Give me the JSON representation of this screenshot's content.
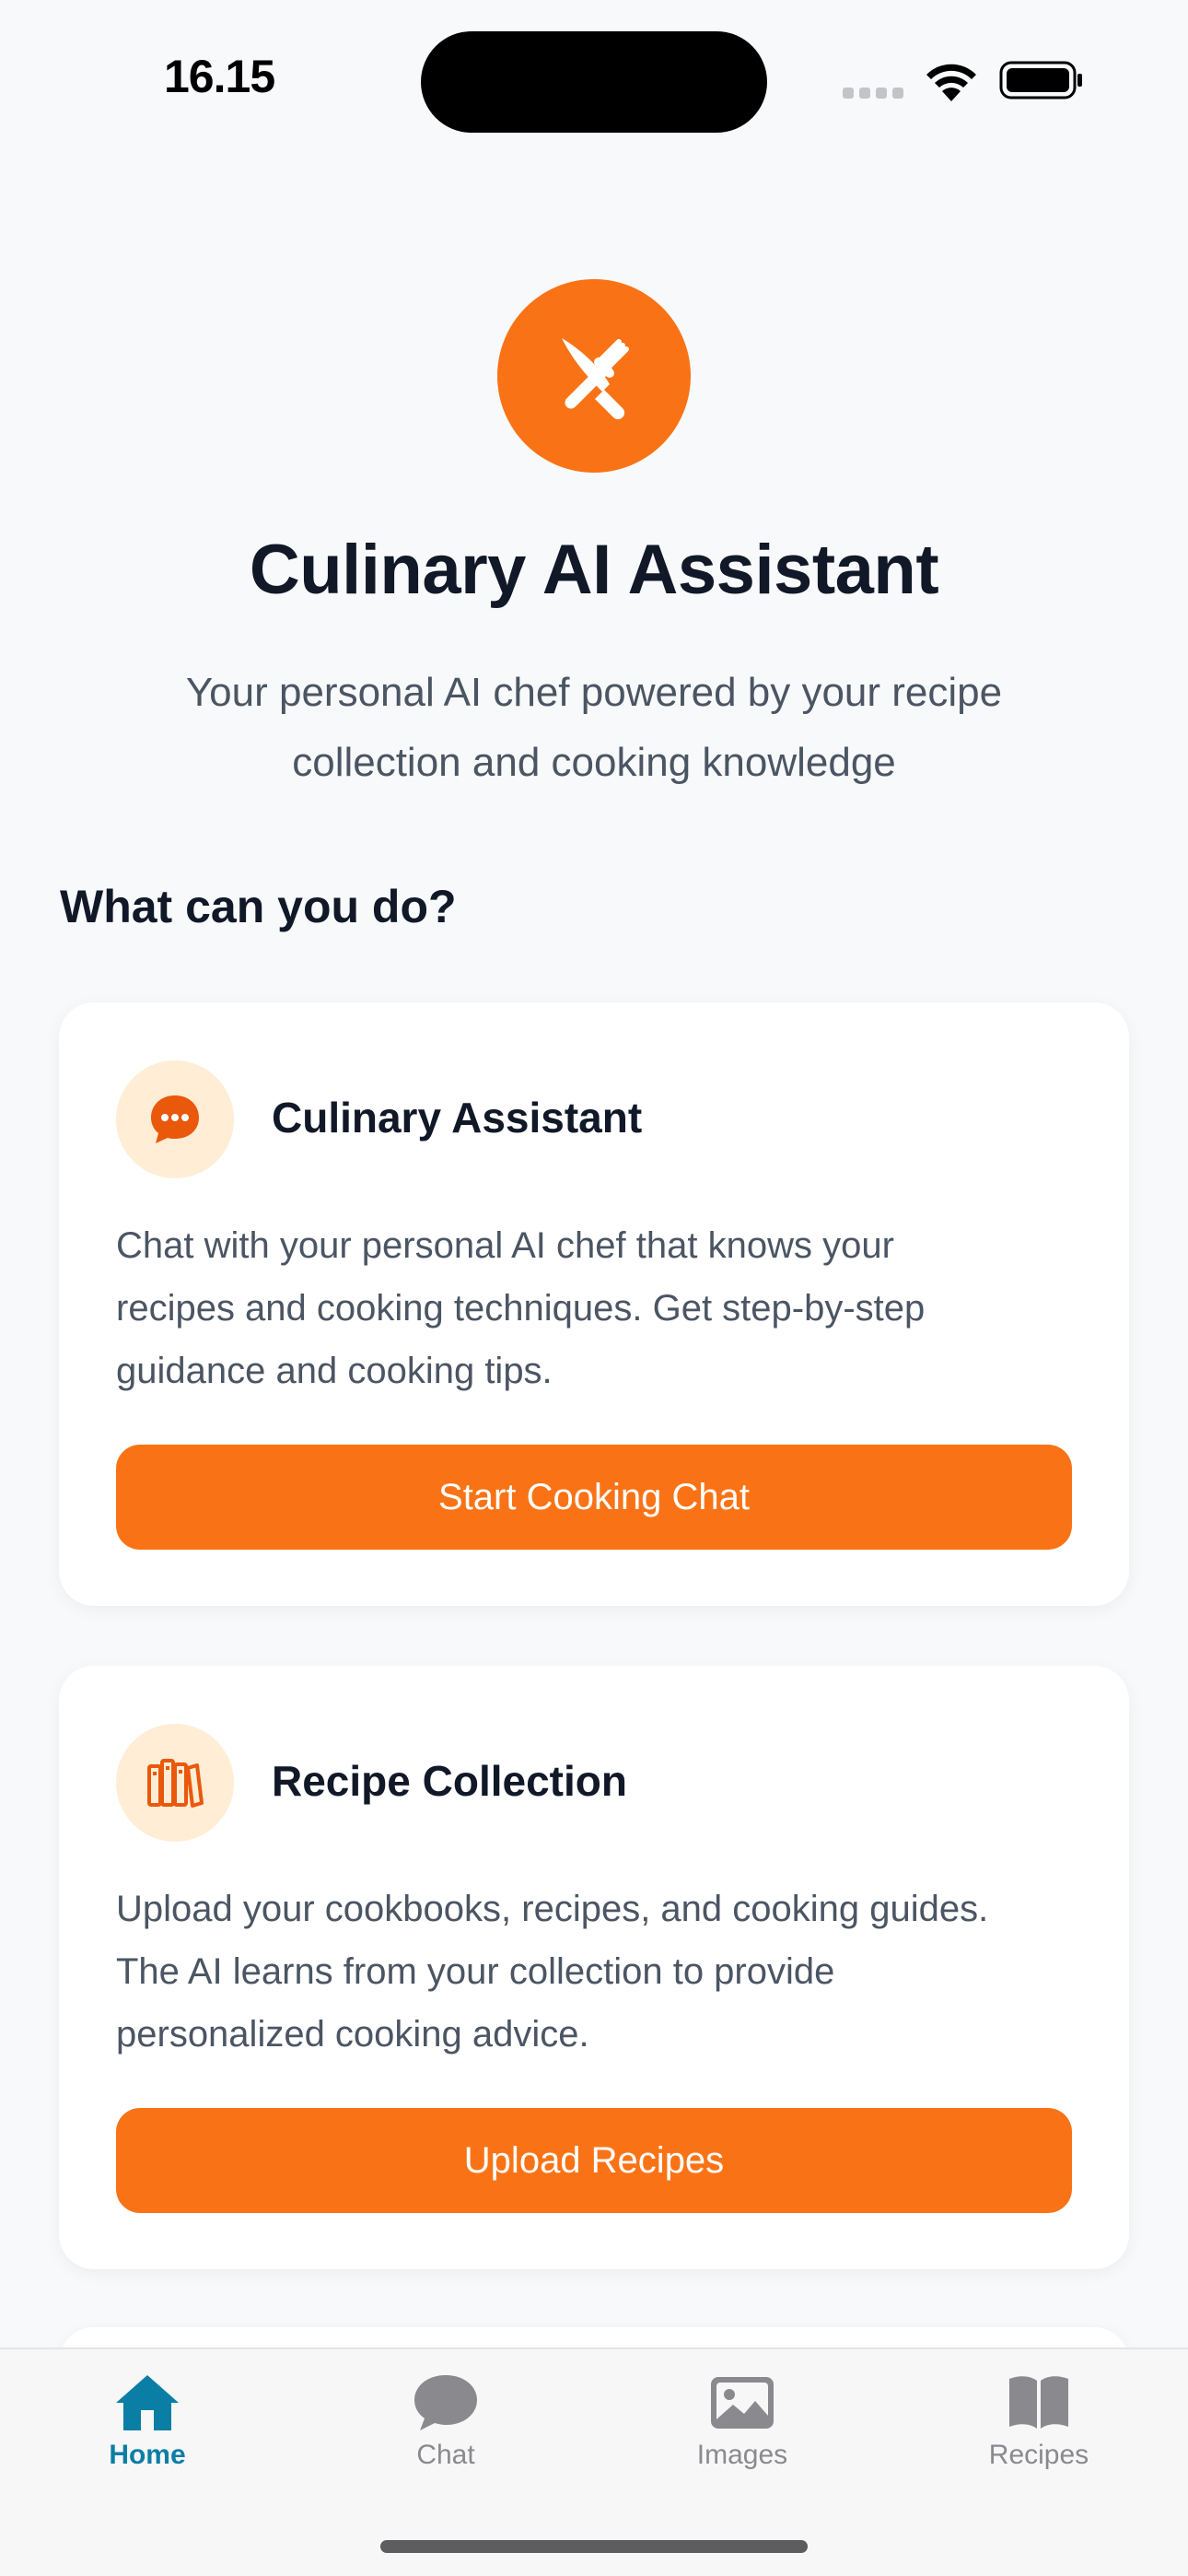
{
  "status_bar": {
    "time": "16.15"
  },
  "hero": {
    "logo_icon": "fork-knife-icon",
    "title": "Culinary AI Assistant",
    "subtitle_line1": "Your personal AI chef powered by your recipe",
    "subtitle_line2": "collection and cooking knowledge"
  },
  "section": {
    "heading": "What can you do?"
  },
  "cards": [
    {
      "icon": "chat-bubble-ellipsis-icon",
      "title": "Culinary Assistant",
      "desc_line1": "Chat with your personal AI chef that knows your",
      "desc_line2": "recipes and cooking techniques. Get step-by-step",
      "desc_line3": "guidance and cooking tips.",
      "button_label": "Start Cooking Chat"
    },
    {
      "icon": "books-icon",
      "title": "Recipe Collection",
      "desc_line1": "Upload your cookbooks, recipes, and cooking guides.",
      "desc_line2": "The AI learns from your collection to provide",
      "desc_line3": "personalized cooking advice.",
      "button_label": "Upload Recipes"
    }
  ],
  "tab_bar": {
    "active": "Home",
    "items": [
      {
        "label": "Home",
        "icon": "house-icon"
      },
      {
        "label": "Chat",
        "icon": "chat-bubble-icon"
      },
      {
        "label": "Images",
        "icon": "image-icon"
      },
      {
        "label": "Recipes",
        "icon": "book-icon"
      }
    ]
  },
  "colors": {
    "accent": "#f97316",
    "accent_light": "#ffedd5",
    "tab_active": "#0a7ea4",
    "tab_inactive": "#8a8a8e",
    "background": "#f8f9fb"
  }
}
